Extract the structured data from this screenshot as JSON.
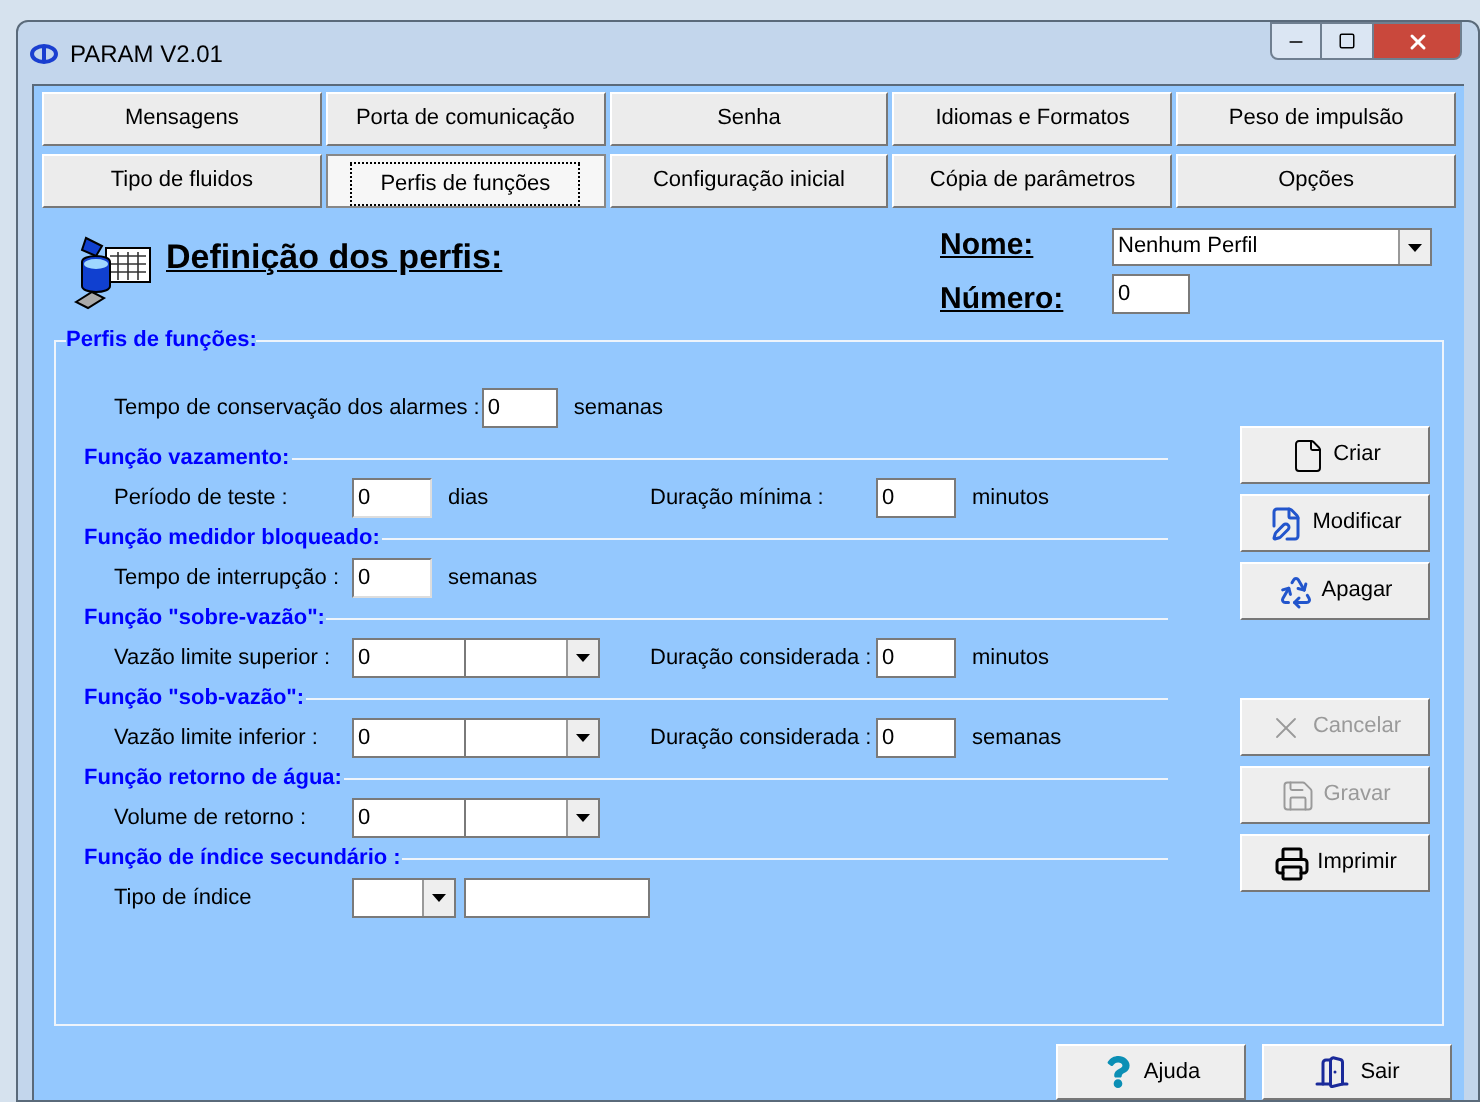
{
  "window": {
    "title": "PARAM V2.01"
  },
  "tabs": [
    [
      {
        "label": "Mensagens",
        "selected": false
      },
      {
        "label": "Porta de comunicação",
        "selected": false
      },
      {
        "label": "Senha",
        "selected": false
      },
      {
        "label": "Idiomas e Formatos",
        "selected": false
      },
      {
        "label": "Peso de impulsão",
        "selected": false
      }
    ],
    [
      {
        "label": "Tipo de fluidos",
        "selected": false
      },
      {
        "label": "Perfis de funções",
        "selected": true
      },
      {
        "label": "Configuração inicial",
        "selected": false
      },
      {
        "label": "Cópia de parâmetros",
        "selected": false
      },
      {
        "label": "Opções",
        "selected": false
      }
    ]
  ],
  "header": {
    "title": "Definição dos perfis:",
    "name_label": "Nome:",
    "name_value": "Nenhum Perfil",
    "number_label": "Número:",
    "number_value": "0"
  },
  "group": {
    "title": "Perfis de funções:",
    "alarm": {
      "label": "Tempo de conservação dos alarmes :",
      "value": "0",
      "unit": "semanas"
    },
    "sections": [
      {
        "title": "Função vazamento:",
        "row": {
          "label": "Período de teste :",
          "inputs": [
            {
              "kind": "text",
              "value": "0"
            }
          ],
          "unit": "dias",
          "extra": {
            "label": "Duração mínima :",
            "value": "0",
            "unit": "minutos"
          }
        }
      },
      {
        "title": "Função medidor bloqueado:",
        "row": {
          "label": "Tempo de interrupção :",
          "inputs": [
            {
              "kind": "text",
              "value": "0"
            }
          ],
          "unit": "semanas"
        }
      },
      {
        "title": "Função \"sobre-vazão\":",
        "row": {
          "label": "Vazão limite superior :",
          "inputs": [
            {
              "kind": "value",
              "value": "0"
            },
            {
              "kind": "combo"
            }
          ],
          "extra": {
            "label": "Duração considerada :",
            "value": "0",
            "unit": "minutos"
          }
        }
      },
      {
        "title": "Função \"sob-vazão\":",
        "row": {
          "label": "Vazão limite inferior :",
          "inputs": [
            {
              "kind": "value",
              "value": "0"
            },
            {
              "kind": "combo"
            }
          ],
          "extra": {
            "label": "Duração considerada :",
            "value": "0",
            "unit": "semanas"
          }
        }
      },
      {
        "title": "Função retorno de água:",
        "row": {
          "label": "Volume de retorno :",
          "inputs": [
            {
              "kind": "value",
              "value": "0"
            },
            {
              "kind": "combo"
            }
          ]
        }
      },
      {
        "title": "Função de índice secundário :",
        "row": {
          "label": "Tipo de índice",
          "inputs": [
            {
              "kind": "wide_combo"
            },
            {
              "kind": "wide_text"
            }
          ]
        }
      }
    ]
  },
  "actions": [
    {
      "label": "Criar",
      "disabled": false
    },
    {
      "label": "Modificar",
      "disabled": false
    },
    {
      "label": "Apagar",
      "disabled": false
    },
    {
      "label": "Cancelar",
      "disabled": true
    },
    {
      "label": "Gravar",
      "disabled": true
    },
    {
      "label": "Imprimir",
      "disabled": false
    }
  ],
  "footer": [
    {
      "label": "Ajuda"
    },
    {
      "label": "Sair"
    }
  ]
}
